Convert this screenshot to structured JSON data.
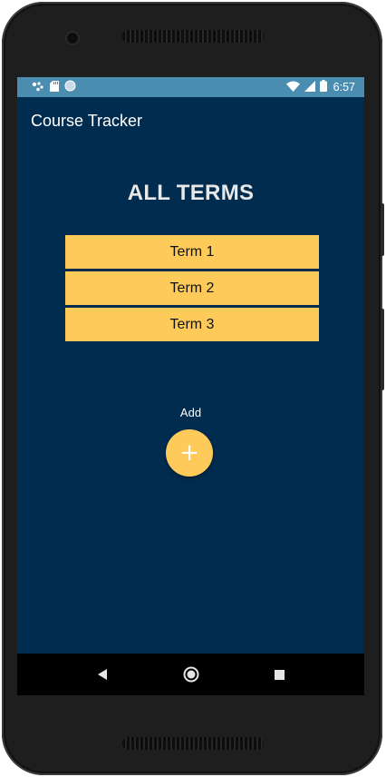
{
  "status_bar": {
    "time": "6:57",
    "left_icons": [
      "assistant-icon",
      "sd-card-icon",
      "circle-icon"
    ],
    "right_icons": [
      "wifi-icon",
      "signal-icon",
      "battery-icon"
    ]
  },
  "app_bar": {
    "title": "Course Tracker"
  },
  "main": {
    "heading": "ALL TERMS",
    "terms": [
      {
        "label": "Term 1"
      },
      {
        "label": "Term 2"
      },
      {
        "label": "Term 3"
      }
    ],
    "add_label": "Add",
    "fab_symbol": "+"
  },
  "nav_bar": {
    "buttons": [
      "back-icon",
      "home-icon",
      "recents-icon"
    ]
  },
  "colors": {
    "background": "#002c4f",
    "status_bar": "#4a8db1",
    "accent": "#fecb5a"
  }
}
